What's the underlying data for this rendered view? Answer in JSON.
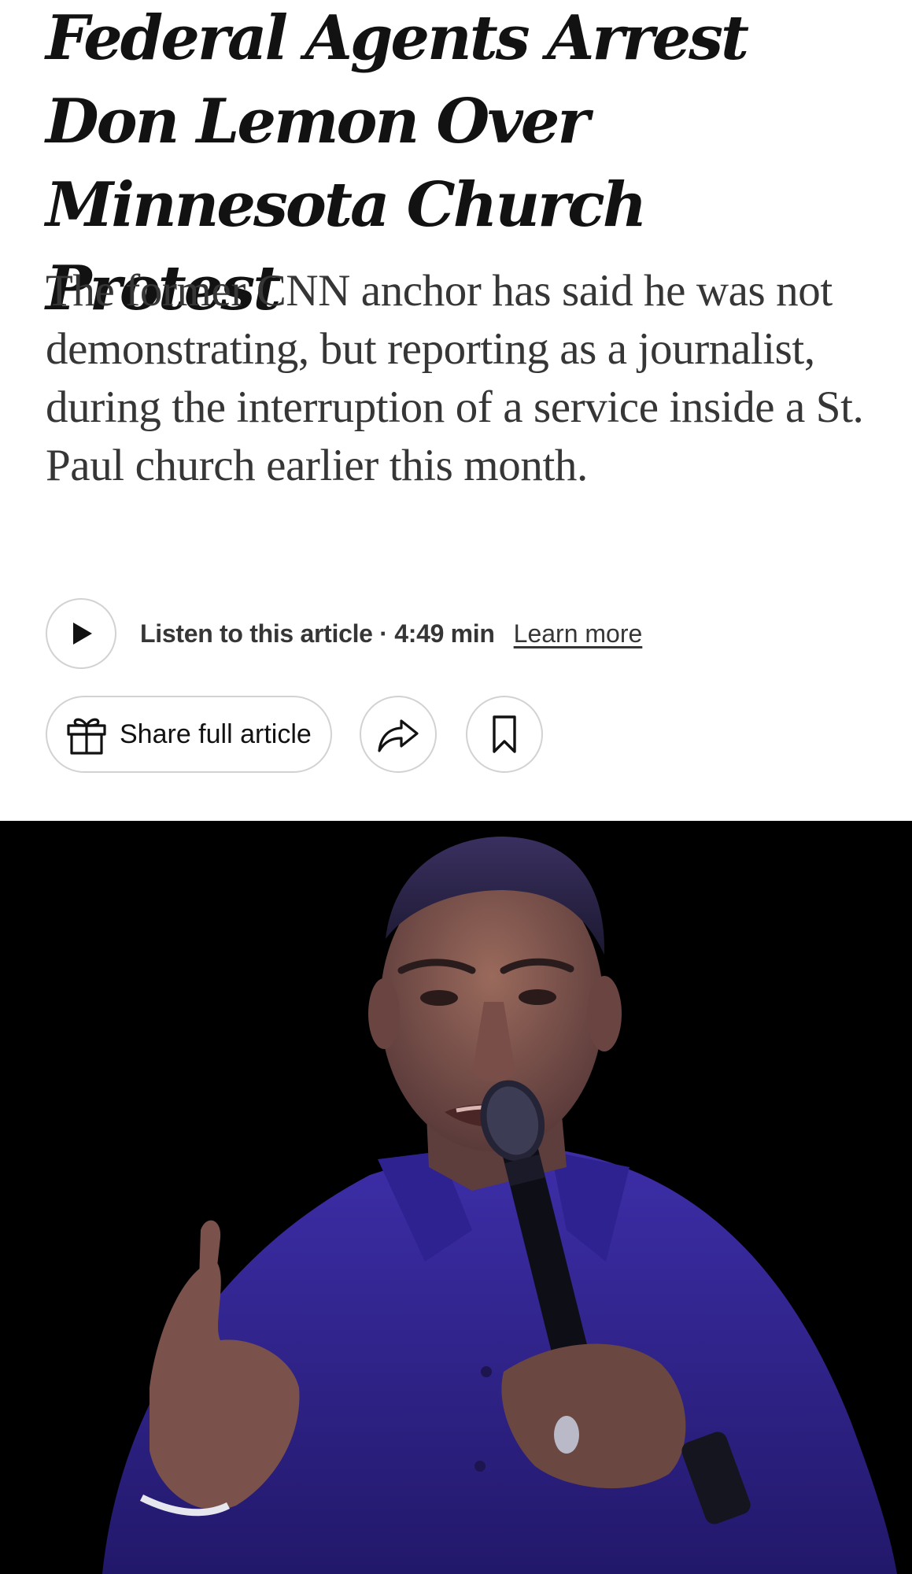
{
  "article": {
    "headline": "Federal Agents Arrest Don Lemon Over Minnesota Church Protest",
    "summary": "The former CNN anchor has said he was not demonstrating, but reporting as a journalist, during the interruption of a service inside a St. Paul church earlier this month."
  },
  "audio": {
    "listen_label": "Listen to this article · 4:49 min",
    "learn_more_label": "Learn more",
    "play_icon": "play-icon"
  },
  "actions": {
    "share_full_label": "Share full article",
    "gift_icon": "gift-icon",
    "share_icon": "share-arrow-icon",
    "save_icon": "bookmark-icon"
  },
  "image": {
    "background_color": "#000000",
    "shirt_color": "#3a2aa0"
  }
}
